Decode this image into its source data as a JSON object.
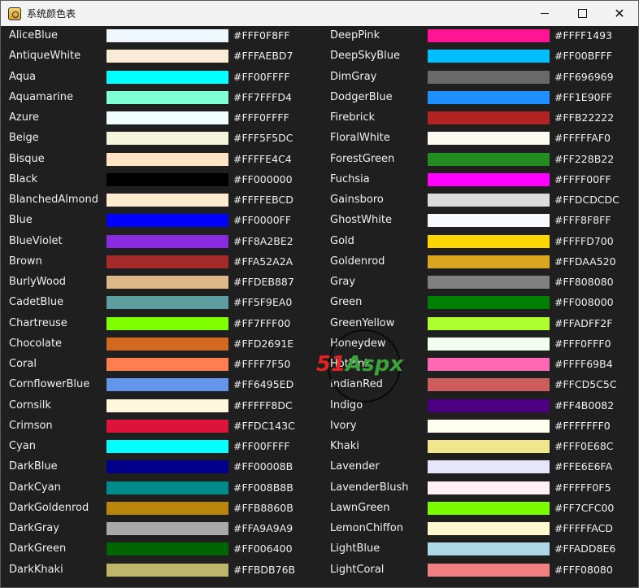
{
  "window": {
    "title": "系统颜色表",
    "controls": {
      "minimize": "",
      "maximize": "",
      "close": "✕"
    }
  },
  "watermark": {
    "part1": "51",
    "part2": "Aspx"
  },
  "left_column": [
    {
      "name": "AliceBlue",
      "hex": "#FFF0F8FF",
      "color": "#F0F8FF"
    },
    {
      "name": "AntiqueWhite",
      "hex": "#FFFAEBD7",
      "color": "#FAEBD7"
    },
    {
      "name": "Aqua",
      "hex": "#FF00FFFF",
      "color": "#00FFFF"
    },
    {
      "name": "Aquamarine",
      "hex": "#FF7FFFD4",
      "color": "#7FFFD4"
    },
    {
      "name": "Azure",
      "hex": "#FFF0FFFF",
      "color": "#F0FFFF"
    },
    {
      "name": "Beige",
      "hex": "#FFF5F5DC",
      "color": "#F5F5DC"
    },
    {
      "name": "Bisque",
      "hex": "#FFFFE4C4",
      "color": "#FFE4C4"
    },
    {
      "name": "Black",
      "hex": "#FF000000",
      "color": "#000000"
    },
    {
      "name": "BlanchedAlmond",
      "hex": "#FFFFEBCD",
      "color": "#FFEBCD"
    },
    {
      "name": "Blue",
      "hex": "#FF0000FF",
      "color": "#0000FF"
    },
    {
      "name": "BlueViolet",
      "hex": "#FF8A2BE2",
      "color": "#8A2BE2"
    },
    {
      "name": "Brown",
      "hex": "#FFA52A2A",
      "color": "#A52A2A"
    },
    {
      "name": "BurlyWood",
      "hex": "#FFDEB887",
      "color": "#DEB887"
    },
    {
      "name": "CadetBlue",
      "hex": "#FF5F9EA0",
      "color": "#5F9EA0"
    },
    {
      "name": "Chartreuse",
      "hex": "#FF7FFF00",
      "color": "#7FFF00"
    },
    {
      "name": "Chocolate",
      "hex": "#FFD2691E",
      "color": "#D2691E"
    },
    {
      "name": "Coral",
      "hex": "#FFFF7F50",
      "color": "#FF7F50"
    },
    {
      "name": "CornflowerBlue",
      "hex": "#FF6495ED",
      "color": "#6495ED"
    },
    {
      "name": "Cornsilk",
      "hex": "#FFFFF8DC",
      "color": "#FFF8DC"
    },
    {
      "name": "Crimson",
      "hex": "#FFDC143C",
      "color": "#DC143C"
    },
    {
      "name": "Cyan",
      "hex": "#FF00FFFF",
      "color": "#00FFFF"
    },
    {
      "name": "DarkBlue",
      "hex": "#FF00008B",
      "color": "#00008B"
    },
    {
      "name": "DarkCyan",
      "hex": "#FF008B8B",
      "color": "#008B8B"
    },
    {
      "name": "DarkGoldenrod",
      "hex": "#FFB8860B",
      "color": "#B8860B"
    },
    {
      "name": "DarkGray",
      "hex": "#FFA9A9A9",
      "color": "#A9A9A9"
    },
    {
      "name": "DarkGreen",
      "hex": "#FF006400",
      "color": "#006400"
    },
    {
      "name": "DarkKhaki",
      "hex": "#FFBDB76B",
      "color": "#BDB76B"
    }
  ],
  "right_column": [
    {
      "name": "DeepPink",
      "hex": "#FFFF1493",
      "color": "#FF1493"
    },
    {
      "name": "DeepSkyBlue",
      "hex": "#FF00BFFF",
      "color": "#00BFFF"
    },
    {
      "name": "DimGray",
      "hex": "#FF696969",
      "color": "#696969"
    },
    {
      "name": "DodgerBlue",
      "hex": "#FF1E90FF",
      "color": "#1E90FF"
    },
    {
      "name": "Firebrick",
      "hex": "#FFB22222",
      "color": "#B22222"
    },
    {
      "name": "FloralWhite",
      "hex": "#FFFFFAF0",
      "color": "#FFFAF0"
    },
    {
      "name": "ForestGreen",
      "hex": "#FF228B22",
      "color": "#228B22"
    },
    {
      "name": "Fuchsia",
      "hex": "#FFFF00FF",
      "color": "#FF00FF"
    },
    {
      "name": "Gainsboro",
      "hex": "#FFDCDCDC",
      "color": "#DCDCDC"
    },
    {
      "name": "GhostWhite",
      "hex": "#FFF8F8FF",
      "color": "#F8F8FF"
    },
    {
      "name": "Gold",
      "hex": "#FFFFD700",
      "color": "#FFD700"
    },
    {
      "name": "Goldenrod",
      "hex": "#FFDAA520",
      "color": "#DAA520"
    },
    {
      "name": "Gray",
      "hex": "#FF808080",
      "color": "#808080"
    },
    {
      "name": "Green",
      "hex": "#FF008000",
      "color": "#008000"
    },
    {
      "name": "GreenYellow",
      "hex": "#FFADFF2F",
      "color": "#ADFF2F"
    },
    {
      "name": "Honeydew",
      "hex": "#FFF0FFF0",
      "color": "#F0FFF0"
    },
    {
      "name": "HotPink",
      "hex": "#FFFF69B4",
      "color": "#FF69B4"
    },
    {
      "name": "IndianRed",
      "hex": "#FFCD5C5C",
      "color": "#CD5C5C"
    },
    {
      "name": "Indigo",
      "hex": "#FF4B0082",
      "color": "#4B0082"
    },
    {
      "name": "Ivory",
      "hex": "#FFFFFFF0",
      "color": "#FFFFF0"
    },
    {
      "name": "Khaki",
      "hex": "#FFF0E68C",
      "color": "#F0E68C"
    },
    {
      "name": "Lavender",
      "hex": "#FFE6E6FA",
      "color": "#E6E6FA"
    },
    {
      "name": "LavenderBlush",
      "hex": "#FFFFF0F5",
      "color": "#FFF0F5"
    },
    {
      "name": "LawnGreen",
      "hex": "#FF7CFC00",
      "color": "#7CFC00"
    },
    {
      "name": "LemonChiffon",
      "hex": "#FFFFFACD",
      "color": "#FFFACD"
    },
    {
      "name": "LightBlue",
      "hex": "#FFADD8E6",
      "color": "#ADD8E6"
    },
    {
      "name": "LightCoral",
      "hex": "#FFF08080",
      "color": "#F08080"
    }
  ]
}
